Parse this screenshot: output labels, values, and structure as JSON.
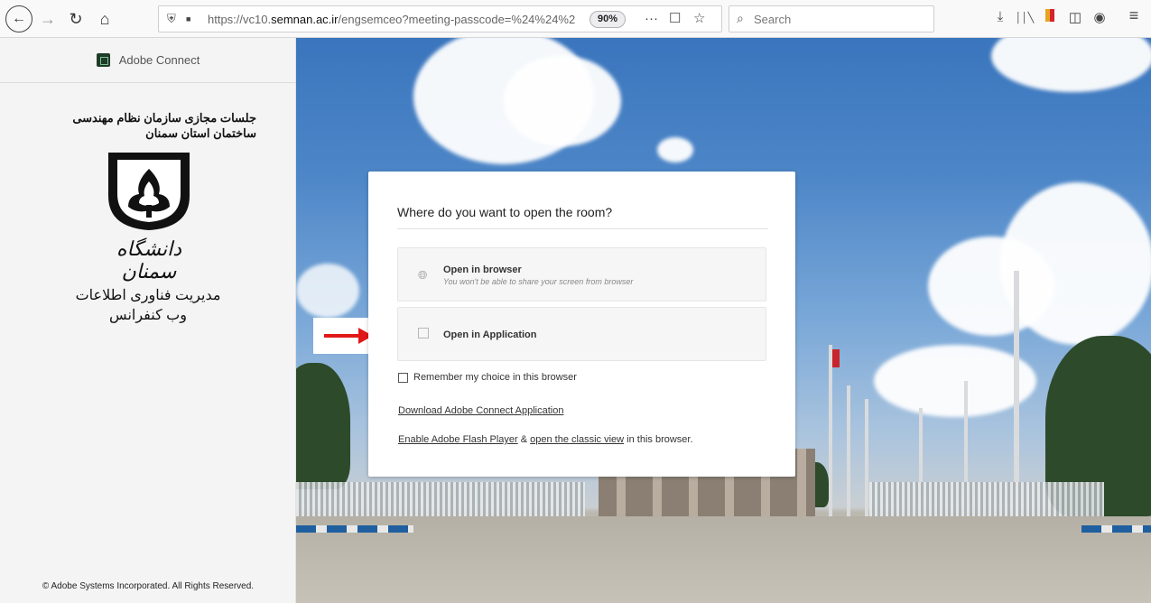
{
  "browser": {
    "url_prefix": "https://vc10.",
    "url_domain": "semnan.ac.ir",
    "url_path": "/engsemceo?meeting-passcode=%24%24%2",
    "zoom": "90%",
    "page_actions_icon": "···",
    "search_placeholder": "Search",
    "icons": {
      "back": "←",
      "forward": "→",
      "reload": "↻",
      "home": "⌂",
      "shield": "⛨",
      "lock": "■",
      "pocket": "☐",
      "bookmark": "☆",
      "search": "⌕",
      "download": "⤓",
      "library": "││╲",
      "sidebar": "◫",
      "account": "◉",
      "menu": "≡"
    }
  },
  "sidebar": {
    "brand_name": "Adobe Connect",
    "org_title": "جلسات مجازی سازمان نظام مهندسی ساختمان استان سمنان",
    "university_calligraphy": "دانشگاه سمنان",
    "dept_title": "مدیریت فناوری اطلاعات",
    "dept_subtitle": "وب کنفرانس",
    "copyright": "© Adobe Systems Incorporated. All Rights Reserved."
  },
  "dialog": {
    "title": "Where do you want to open the room?",
    "options": [
      {
        "label": "Open in browser",
        "sublabel": "You won't be able to share your screen from browser",
        "icon": "globe-icon"
      },
      {
        "label": "Open in Application",
        "icon": "app-icon"
      }
    ],
    "remember_label": "Remember my choice in this browser",
    "remember_checked": false,
    "download_link": "Download Adobe Connect Application",
    "flash_link": "Enable Adobe Flash Player",
    "flash_mid": " & ",
    "classic_link": "open the classic view",
    "flash_tail": " in this browser."
  },
  "colors": {
    "arrow": "#e11818",
    "sky": "#4e87c8"
  }
}
